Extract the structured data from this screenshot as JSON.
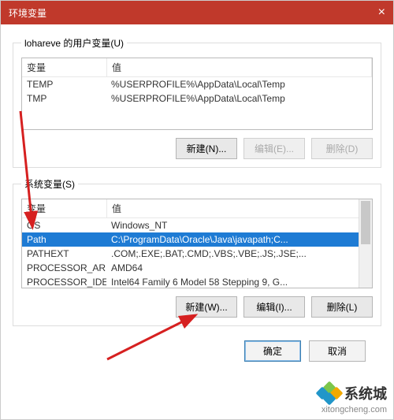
{
  "title": "环境变量",
  "user_section": {
    "legend": "lohareve 的用户变量(U)",
    "header_name": "变量",
    "header_value": "值",
    "rows": [
      {
        "name": "TEMP",
        "value": "%USERPROFILE%\\AppData\\Local\\Temp"
      },
      {
        "name": "TMP",
        "value": "%USERPROFILE%\\AppData\\Local\\Temp"
      }
    ],
    "buttons": {
      "new": "新建(N)...",
      "edit": "编辑(E)...",
      "delete": "删除(D)"
    }
  },
  "sys_section": {
    "legend": "系统变量(S)",
    "header_name": "变量",
    "header_value": "值",
    "rows": [
      {
        "name": "OS",
        "value": "Windows_NT",
        "selected": false
      },
      {
        "name": "Path",
        "value": "C:\\ProgramData\\Oracle\\Java\\javapath;C...",
        "selected": true
      },
      {
        "name": "PATHEXT",
        "value": ".COM;.EXE;.BAT;.CMD;.VBS;.VBE;.JS;.JSE;...",
        "selected": false
      },
      {
        "name": "PROCESSOR_AR...",
        "value": "AMD64",
        "selected": false
      },
      {
        "name": "PROCESSOR_IDE...",
        "value": "Intel64 Family 6 Model 58 Stepping 9, G...",
        "selected": false
      }
    ],
    "buttons": {
      "new": "新建(W)...",
      "edit": "编辑(I)...",
      "delete": "删除(L)"
    }
  },
  "dialog_buttons": {
    "ok": "确定",
    "cancel": "取消"
  },
  "watermark": {
    "brand": "系统城",
    "url": "xitongcheng.com"
  }
}
